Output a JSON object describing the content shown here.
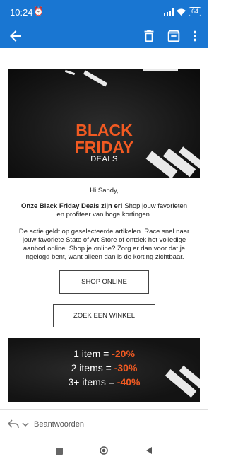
{
  "status_bar": {
    "time": "10:24",
    "battery": "64"
  },
  "email": {
    "hero": {
      "title_line1": "BLACK",
      "title_line2": "FRIDAY",
      "subtitle": "DEALS"
    },
    "greeting": "Hi Sandy,",
    "intro_bold": "Onze Black Friday Deals zijn er!",
    "intro_rest": " Shop jouw favorieten en profiteer van hoge kortingen.",
    "body": "De actie geldt op geselecteerde artikelen. Race snel naar jouw favoriete State of Art Store of ontdek het volledige aanbod online. Shop je online? Zorg er dan voor dat je ingelogd bent, want alleen dan is de korting zichtbaar.",
    "buttons": {
      "shop_online": "SHOP ONLINE",
      "find_store": "ZOEK EEN WINKEL"
    },
    "promo": [
      {
        "label": "1 item = ",
        "value": "-20%"
      },
      {
        "label": "2 items = ",
        "value": "-30%"
      },
      {
        "label": "3+ items = ",
        "value": "-40%"
      }
    ]
  },
  "reply_bar": {
    "label": "Beantwoorden"
  },
  "colors": {
    "app_bar": "#1976d2",
    "accent": "#f15a22"
  }
}
